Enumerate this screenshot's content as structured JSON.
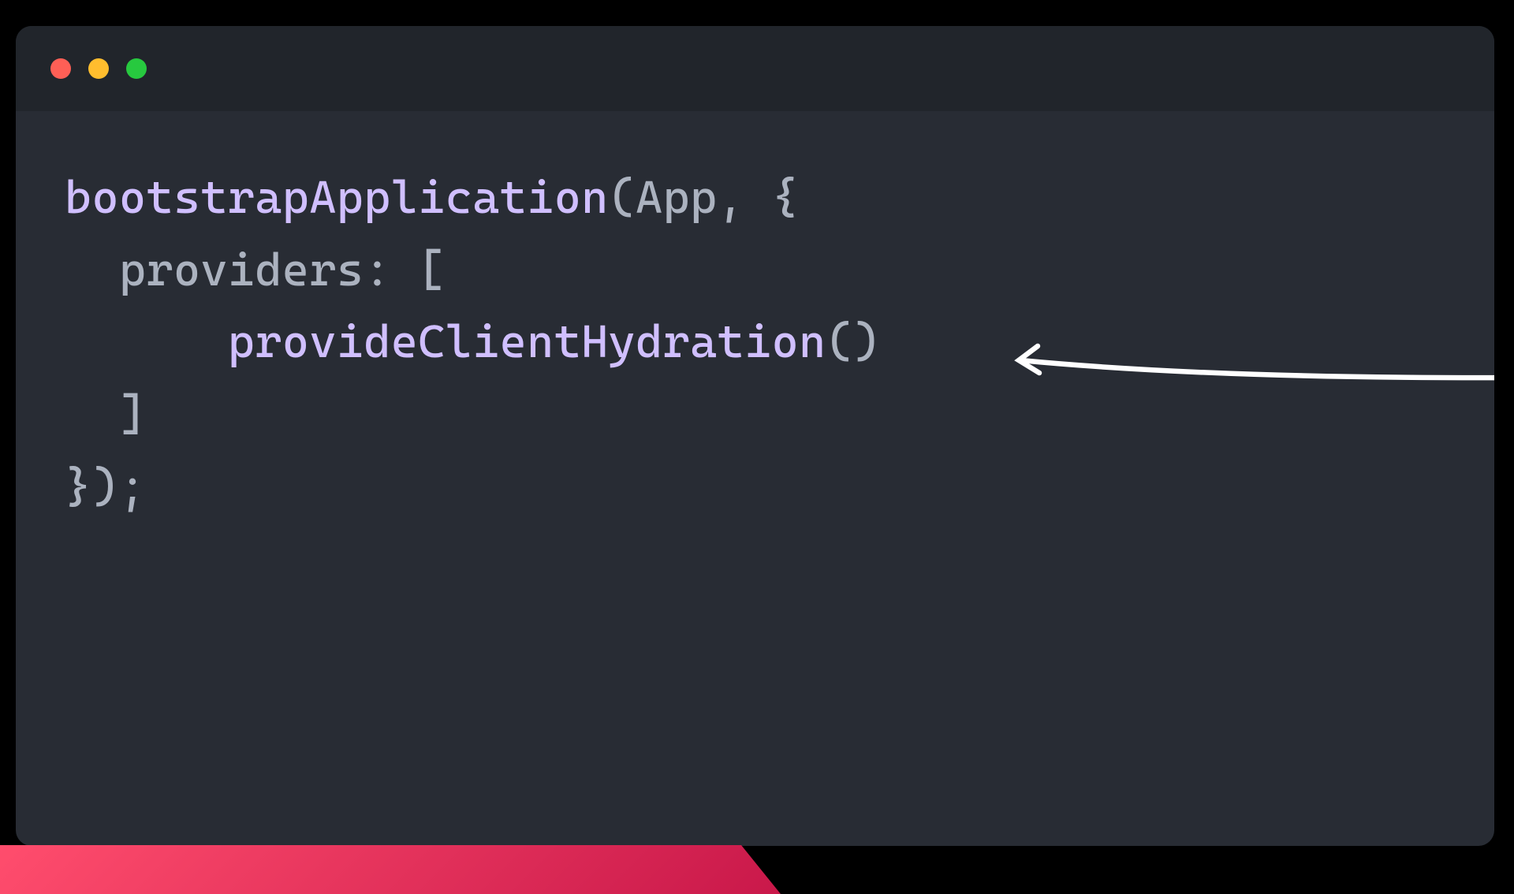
{
  "code": {
    "line1_fn": "bootstrapApplication",
    "line1_rest": "(App, {",
    "line2_key": "providers",
    "line2_rest": ": [",
    "line3_fn": "provideClientHydration",
    "line3_rest": "()",
    "line4": "  ]",
    "line5": "});"
  },
  "traffic_lights": {
    "close": "#ff5f56",
    "minimize": "#ffbd2e",
    "zoom": "#27c93f"
  }
}
